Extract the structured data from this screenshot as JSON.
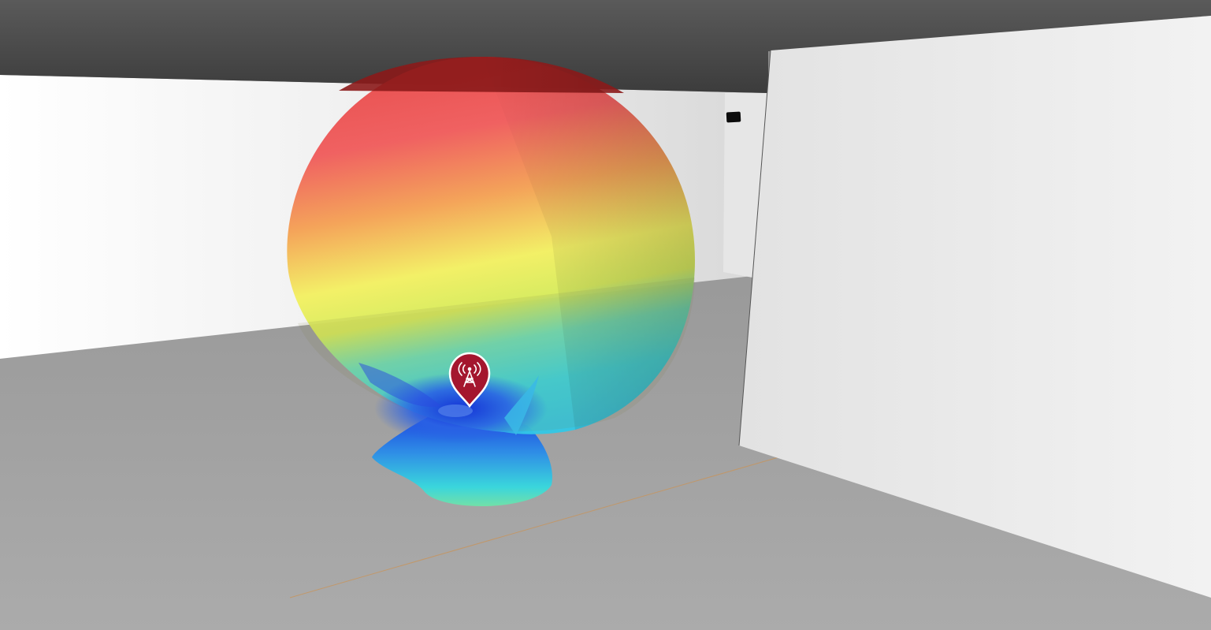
{
  "viewport": {
    "label": "",
    "view_mode": "3d-perspective"
  },
  "room": {
    "ceiling_color": "#4a4a4a",
    "wall_color": "#f0f0f0",
    "floor_color": "#9b9b9b"
  },
  "radiation_pattern": {
    "colormap": [
      "#8b1a1a",
      "#f05a5a",
      "#f5a050",
      "#f4f060",
      "#6ee0b8",
      "#3ad6e0",
      "#1a3ae0"
    ]
  },
  "transmitter": {
    "icon": "antenna-tower-icon",
    "marker_color": "#a4162e"
  },
  "wall_object": {
    "icon": "small-black-box"
  }
}
